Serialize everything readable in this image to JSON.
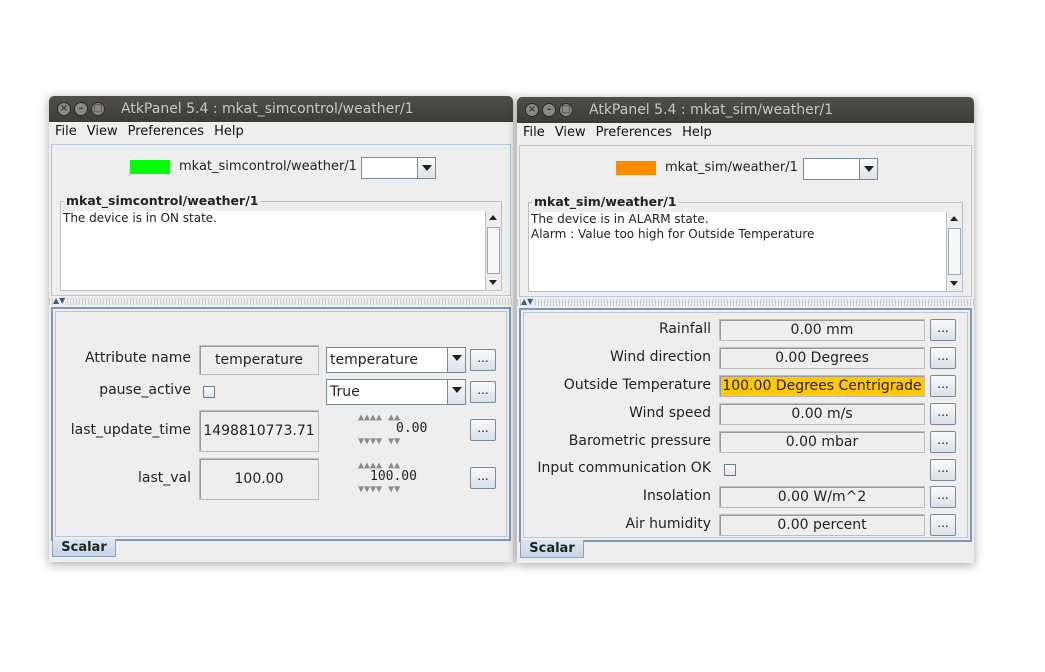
{
  "left_window": {
    "title": "AtkPanel  5.4  : mkat_simcontrol/weather/1",
    "menu": [
      "File",
      "View",
      "Preferences",
      "Help"
    ],
    "state_color": "#00ff00",
    "device_name": "mkat_simcontrol/weather/1",
    "group_title": "mkat_simcontrol/weather/1",
    "status_text": "The device is in ON state.",
    "tab_label": "Scalar",
    "attributes": {
      "attribute_name_label": "Attribute name",
      "attribute_name_value": "temperature",
      "attribute_name_combo": "temperature",
      "pause_active_label": "pause_active",
      "pause_active_combo": "True",
      "last_update_time_label": "last_update_time",
      "last_update_time_value": "1498810773.71",
      "last_update_time_wheel": "0.00",
      "last_val_label": "last_val",
      "last_val_value": "100.00",
      "last_val_wheel": "100.00"
    }
  },
  "right_window": {
    "title": "AtkPanel  5.4  : mkat_sim/weather/1",
    "menu": [
      "File",
      "View",
      "Preferences",
      "Help"
    ],
    "state_color": "#ff8c00",
    "device_name": "mkat_sim/weather/1",
    "group_title": "mkat_sim/weather/1",
    "status_text": "The device is in ALARM state.\nAlarm : Value too high for Outside Temperature",
    "tab_label": "Scalar",
    "attributes": [
      {
        "label": "Rainfall",
        "value": "0.00 mm",
        "alarm": false
      },
      {
        "label": "Wind direction",
        "value": "0.00 Degrees",
        "alarm": false
      },
      {
        "label": "Outside Temperature",
        "value": "100.00 Degrees Centrigrade",
        "alarm": true
      },
      {
        "label": "Wind speed",
        "value": "0.00 m/s",
        "alarm": false
      },
      {
        "label": "Barometric pressure",
        "value": "0.00 mbar",
        "alarm": false
      },
      {
        "label": "Input communication OK",
        "value": "",
        "alarm": false,
        "checkbox": true
      },
      {
        "label": "Insolation",
        "value": "0.00 W/m^2",
        "alarm": false
      },
      {
        "label": "Air humidity",
        "value": "0.00 percent",
        "alarm": false
      }
    ],
    "alarm_color": "#ffc800"
  },
  "dots_label": "...",
  "icons": {
    "close": "close-icon",
    "minimize": "minimize-icon",
    "maximize": "maximize-icon"
  }
}
